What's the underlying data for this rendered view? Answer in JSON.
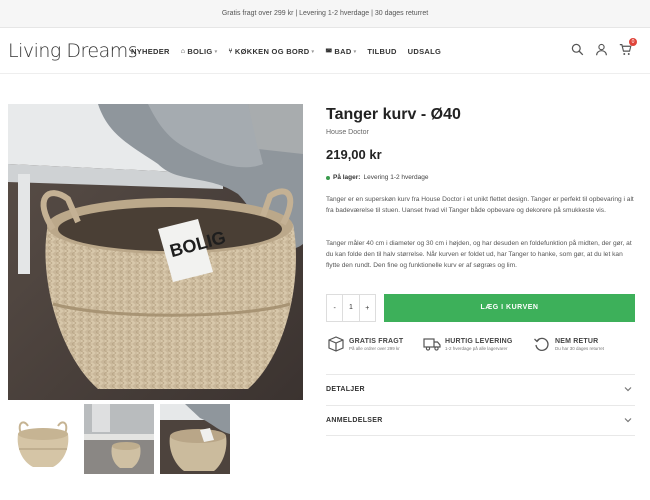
{
  "topbar": {
    "text": "Gratis fragt over 299 kr | Levering 1-2 hverdage | 30 dages returret"
  },
  "header": {
    "logo": "Living Dreams",
    "nav": [
      {
        "label": "NYHEDER",
        "icon": ""
      },
      {
        "label": "BOLIG",
        "icon": "home-icon"
      },
      {
        "label": "KØKKEN OG BORD",
        "icon": "utensils-icon"
      },
      {
        "label": "BAD",
        "icon": "bath-icon"
      },
      {
        "label": "TILBUD",
        "icon": ""
      },
      {
        "label": "UDSALG",
        "icon": ""
      }
    ],
    "cart_count": "0"
  },
  "product": {
    "title": "Tanger kurv - Ø40",
    "brand": "House Doctor",
    "price": "219,00 kr",
    "stock_label": "På lager:",
    "stock_text": "Levering 1-2 hverdage",
    "description_1": "Tanger er en superskøn kurv fra House Doctor i et unikt flettet design. Tanger er perfekt til opbevaring i alt fra badeværelse til stuen. Uanset hvad vil Tanger både opbevare og dekorere på smukkeste vis.",
    "description_2": "Tanger måler 40 cm i diameter og 30 cm i højden, og har desuden en foldefunktion på midten, der gør, at du kan folde den til halv størrelse. Når kurven er foldet ud, har Tanger to hanke, som gør, at du let kan flytte den rundt. Den fine og funktionelle kurv er af søgræs og lim.",
    "quantity": "1",
    "qty_minus": "-",
    "qty_plus": "+",
    "add_to_cart": "LÆG I KURVEN",
    "magazine_text": "BOLIG"
  },
  "features": [
    {
      "title": "GRATIS FRAGT",
      "sub": "På alle ordrer over 299 kr",
      "icon": "box-icon"
    },
    {
      "title": "HURTIG LEVERING",
      "sub": "1-2 hverdage på alle lagervarer",
      "icon": "truck-icon"
    },
    {
      "title": "NEM RETUR",
      "sub": "Du har 30 dages returret",
      "icon": "return-icon"
    }
  ],
  "accordion": [
    {
      "label": "DETALJER"
    },
    {
      "label": "ANMELDELSER"
    }
  ],
  "colors": {
    "accent": "#3db05a",
    "badge": "#e0443a",
    "stock_dot": "#3a9b4d"
  }
}
